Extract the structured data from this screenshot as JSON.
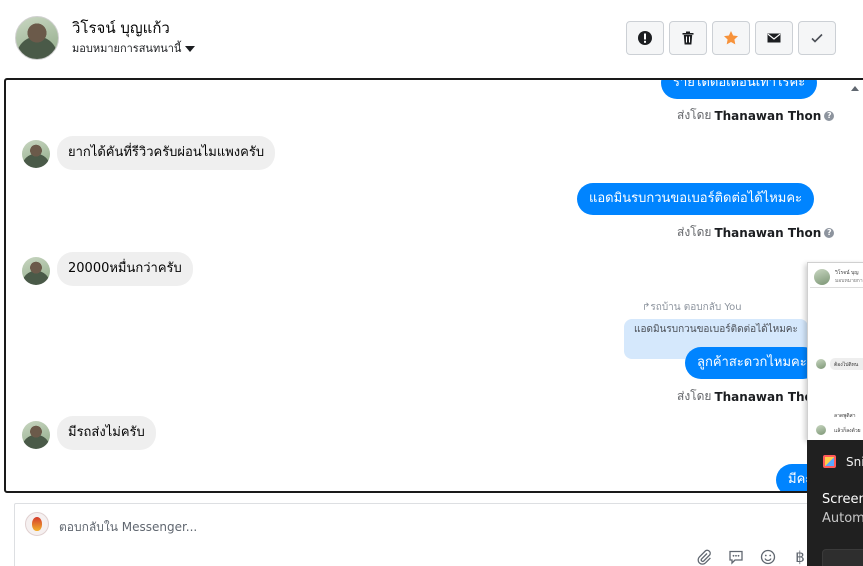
{
  "header": {
    "contact_name": "วิโรจน์ บุญแก้ว",
    "assign_label": "มอบหมายการสนทนานี้",
    "actions": [
      {
        "name": "mark-spam",
        "icon": "exclamation-circle-icon"
      },
      {
        "name": "delete",
        "icon": "trash-icon"
      },
      {
        "name": "star",
        "icon": "star-icon",
        "color": "#f7923a"
      },
      {
        "name": "mark-unread",
        "icon": "envelope-icon"
      },
      {
        "name": "mark-done",
        "icon": "checkmark-icon"
      }
    ]
  },
  "messages": {
    "m1_text": "รายได้ต่อเดือนเท่าไรคะ",
    "m1_sent_prefix": "ส่งโดย",
    "m1_sender": "Thanawan Thon",
    "m2_text": "ยากได้คันที่รีวิวครับผ่อนไมแพงครับ",
    "m3_text": "แอดมินรบกวนขอเบอร์ติดต่อได้ไหมคะ",
    "m3_sent_prefix": "ส่งโดย",
    "m3_sender": "Thanawan Thon",
    "m4_text": "20000หมื่นกว่าครับ",
    "m5_reply_note": "รถบ้าน ตอบกลับ You",
    "m5_quoted": "แอดมินรบกวนขอเบอร์ติดต่อได้ไหมคะ",
    "m5_text": "ลูกค้าสะดวกไหมคะ",
    "m5_sent_prefix": "ส่งโดย",
    "m5_sender": "Thanawan Thon",
    "m6_text": "มีรถส่งไม่ครับ",
    "m7_text": "มีคะ"
  },
  "composer": {
    "placeholder": "ตอบกลับใน Messenger...",
    "tools": [
      "paperclip-icon",
      "speech-bubble-icon",
      "smiley-icon",
      "baht-icon"
    ]
  },
  "overlay": {
    "tiny_name": "วิโรจน์ บุญ",
    "tiny_sub": "มอบหมายการ",
    "tiny_msg1": "ต้องไปดิหน",
    "tiny_msg2": "ลาดพูดิสา",
    "tiny_msg3": "แล้วก็ลงด้วย",
    "snip_label": "Sni",
    "line1": "Screen",
    "line2": "Autom"
  },
  "colors": {
    "outgoing_bubble": "#0084ff",
    "incoming_bubble": "#efefef",
    "quoted_bubble": "#d5e8fc",
    "star": "#f7923a"
  }
}
